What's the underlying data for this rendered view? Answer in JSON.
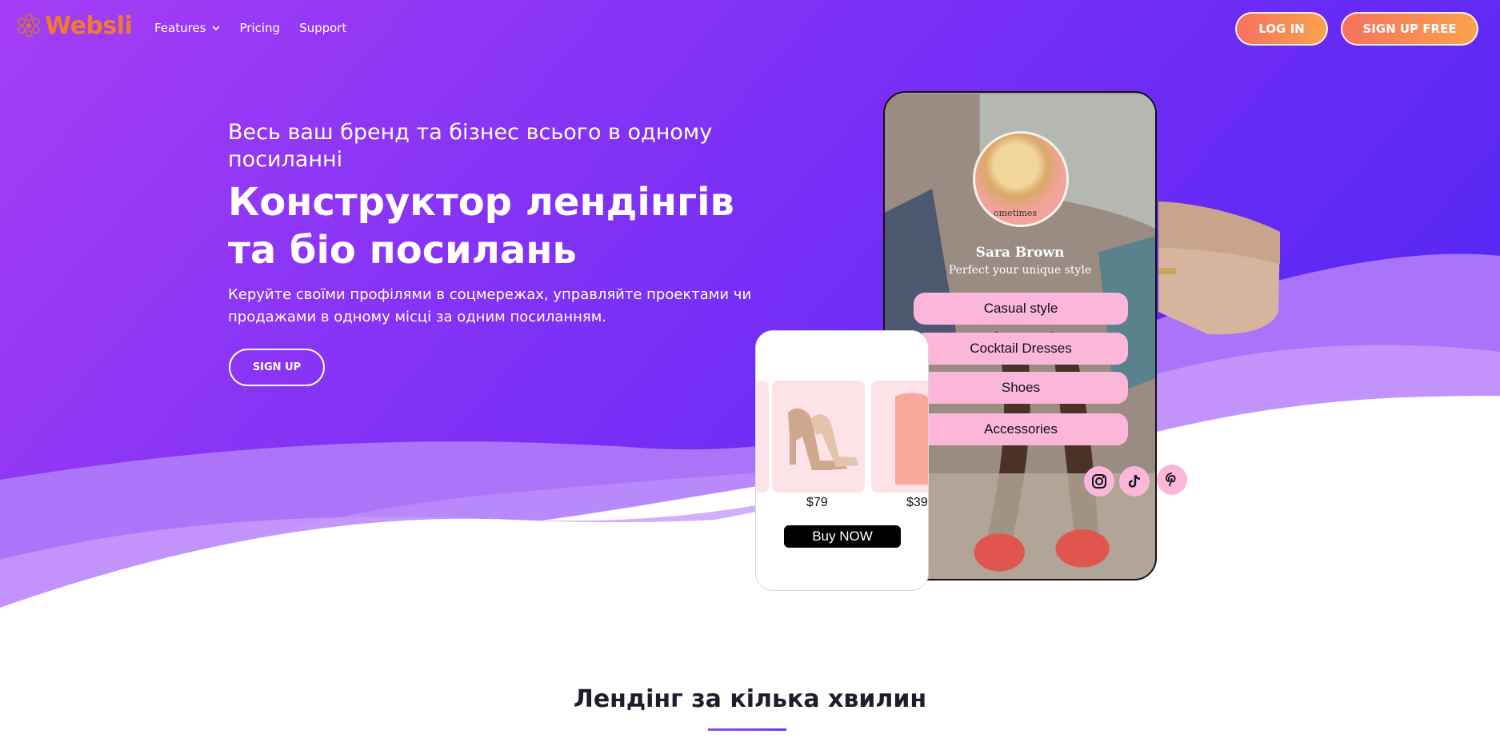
{
  "nav": {
    "logo_text": "Websli",
    "features_label": "Features",
    "pricing_label": "Pricing",
    "support_label": "Support",
    "login_label": "LOG IN",
    "signup_free_label": "SIGN UP FREE"
  },
  "hero": {
    "subtitle": "Весь ваш бренд та бізнес всього в одному посиланні",
    "title": "Конструктор лендінгів та біо посилань",
    "description": "Керуйте своїми профілями в соцмережах, управляйте проектами чи продажами в одному місці за одним посиланням.",
    "signup_label": "SIGN UP"
  },
  "phone": {
    "profile_name": "Sara Brown",
    "profile_tagline": "Perfect your unique style",
    "avatar_text": "ometimes",
    "links": [
      "Casual style",
      "Cocktail Dresses",
      "Shoes",
      "Accessories"
    ],
    "socials": [
      "instagram-icon",
      "tiktok-icon",
      "pinterest-icon"
    ]
  },
  "shop": {
    "price_1": "$79",
    "price_2": "$39",
    "buy_label": "Buy NOW"
  },
  "section": {
    "title": "Лендінг за кілька хвилин"
  },
  "colors": {
    "hero_start": "#9a3cf5",
    "hero_end": "#5a2cf5",
    "accent_orange": "#f7715f",
    "link_pink": "#fcb6d9",
    "logo_orange": "#f07b2a"
  }
}
